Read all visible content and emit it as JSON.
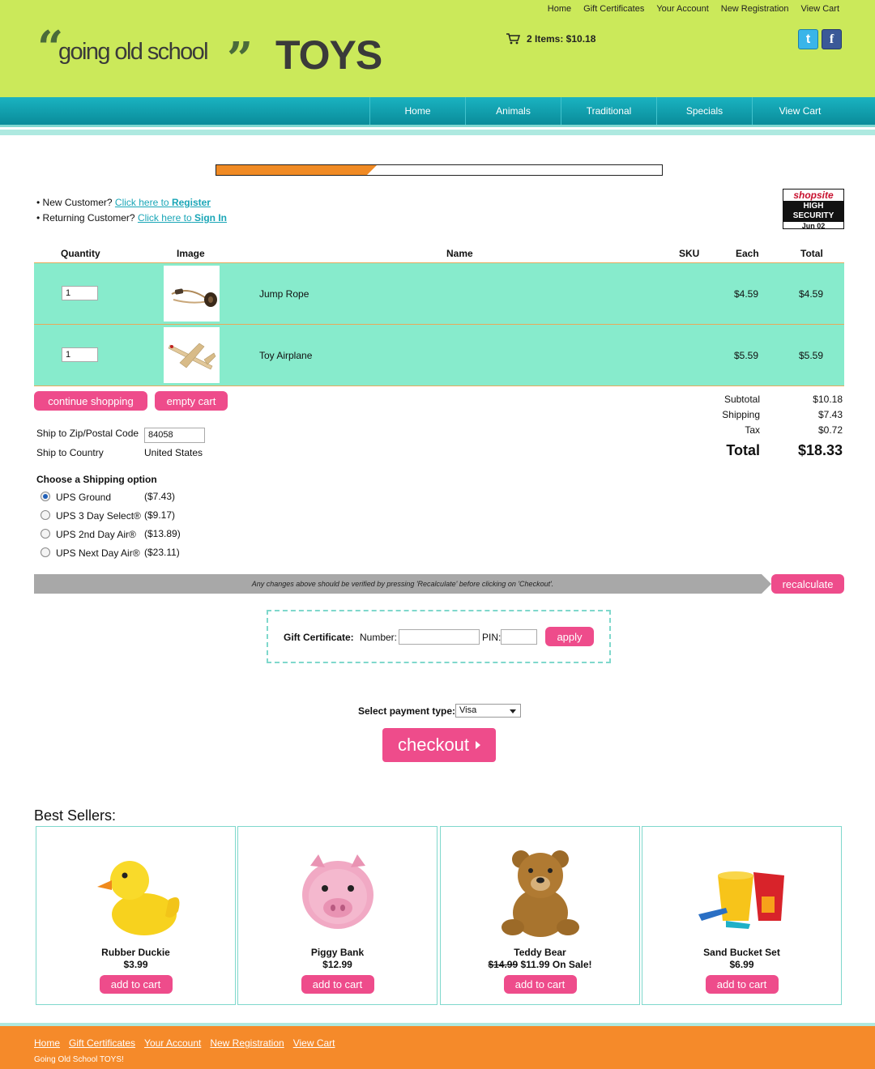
{
  "header": {
    "top_links": [
      "Home",
      "Gift Certificates",
      "Your Account",
      "New Registration",
      "View Cart"
    ],
    "logo_text": "going old school",
    "logo_toys": "TOYS",
    "cart_summary": "2 Items: $10.18",
    "colors": {
      "header_bg": "#cbe95a",
      "nav_bg": "#0a8c9a",
      "accent_pink": "#ee4c8b",
      "accent_orange": "#f58a2a",
      "row_bg": "#87ebcc"
    }
  },
  "nav": [
    "Home",
    "Animals",
    "Traditional",
    "Specials",
    "View Cart"
  ],
  "progress": {
    "fraction": 0.36
  },
  "login": {
    "new_prefix": "• New Customer?",
    "new_link_a": "Click here to",
    "new_link_b": "Register",
    "return_prefix": "• Returning Customer?",
    "return_link_a": "Click here to",
    "return_link_b": "Sign In"
  },
  "badge": {
    "brand": "shopsite",
    "line1": "HIGH",
    "line2": "SECURITY",
    "date": "Jun 02"
  },
  "cart": {
    "headers": {
      "quantity": "Quantity",
      "image": "Image",
      "name": "Name",
      "sku": "SKU",
      "each": "Each",
      "total": "Total"
    },
    "items": [
      {
        "qty": "1",
        "name": "Jump Rope",
        "each": "$4.59",
        "total": "$4.59"
      },
      {
        "qty": "1",
        "name": "Toy Airplane",
        "each": "$5.59",
        "total": "$5.59"
      }
    ],
    "continue_label": "continue shopping",
    "empty_label": "empty cart"
  },
  "totals": {
    "subtotal_label": "Subtotal",
    "subtotal": "$10.18",
    "shipping_label": "Shipping",
    "shipping": "$7.43",
    "tax_label": "Tax",
    "tax": "$0.72",
    "total_label": "Total",
    "total": "$18.33"
  },
  "ship": {
    "zip_label": "Ship to Zip/Postal Code",
    "zip_value": "84058",
    "country_label": "Ship to Country",
    "country_value": "United States",
    "options_title": "Choose a Shipping option",
    "options": [
      {
        "label": "UPS Ground",
        "price": "($7.43)",
        "selected": true
      },
      {
        "label": "UPS 3 Day Select®",
        "price": "($9.17)",
        "selected": false
      },
      {
        "label": "UPS 2nd Day Air®",
        "price": "($13.89)",
        "selected": false
      },
      {
        "label": "UPS Next Day Air®",
        "price": "($23.11)",
        "selected": false
      }
    ]
  },
  "notice": "Any changes above should be verified by pressing 'Recalculate' before clicking on 'Checkout'.",
  "recalculate_label": "recalculate",
  "gift": {
    "label": "Gift Certificate:",
    "number_label": "Number:",
    "pin_label": "PIN:",
    "apply_label": "apply"
  },
  "payment": {
    "label": "Select payment type:",
    "selected": "Visa",
    "checkout_label": "checkout"
  },
  "best_sellers": {
    "title": "Best Sellers:",
    "products": [
      {
        "name": "Rubber Duckie",
        "price": "$3.99",
        "old_price": "",
        "btn": "add to cart",
        "icon": "duck-icon"
      },
      {
        "name": "Piggy Bank",
        "price": "$12.99",
        "old_price": "",
        "btn": "add to cart",
        "icon": "piggy-bank-icon"
      },
      {
        "name": "Teddy Bear",
        "price": "$11.99 On Sale!",
        "old_price": "$14.99",
        "btn": "add to cart",
        "icon": "teddy-bear-icon"
      },
      {
        "name": "Sand Bucket Set",
        "price": "$6.99",
        "old_price": "",
        "btn": "add to cart",
        "icon": "sand-bucket-icon"
      }
    ]
  },
  "footer": {
    "links": [
      "Home",
      "Gift Certificates",
      "Your Account",
      "New Registration",
      "View Cart"
    ],
    "copy": "Going Old School TOYS!"
  }
}
